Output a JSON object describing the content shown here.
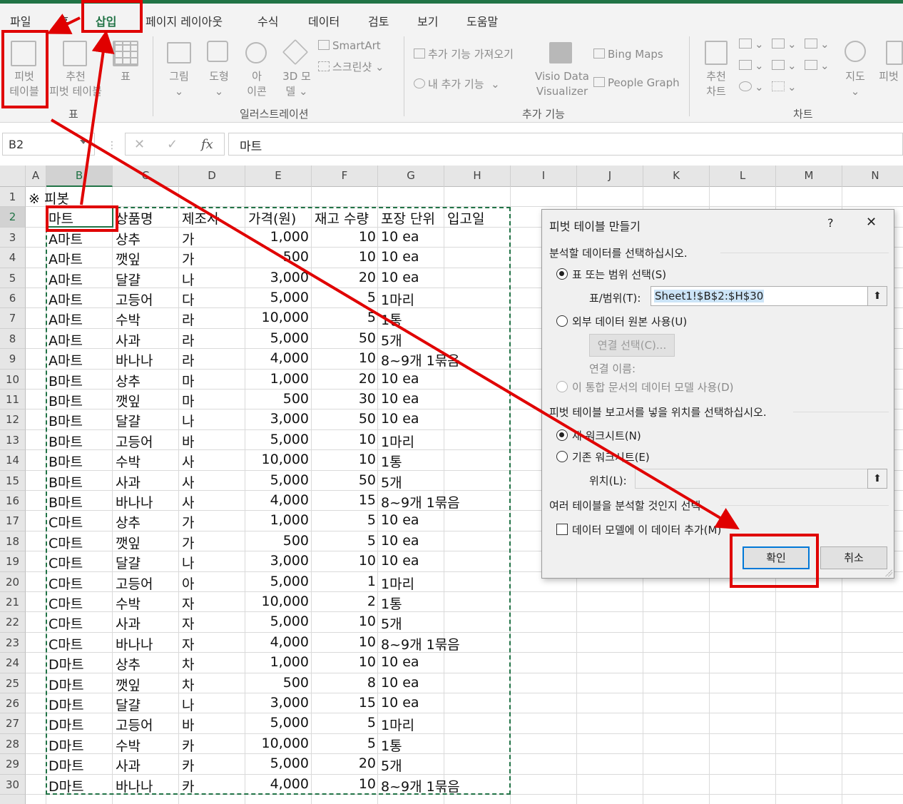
{
  "ribbon_tabs": [
    "파일",
    "홈",
    "삽입",
    "페이지 레이아웃",
    "수식",
    "데이터",
    "검토",
    "보기",
    "도움말"
  ],
  "ribbon": {
    "pivot_table": [
      "피벗",
      "테이블"
    ],
    "recommended_pivot": [
      "추천",
      "피벗 테이블"
    ],
    "table": "표",
    "group_table": "표",
    "picture": "그림",
    "shapes": "도형",
    "icons": [
      "아",
      "이콘"
    ],
    "models_3d": [
      "3D 모",
      "델"
    ],
    "smartart": "SmartArt",
    "screenshot": "스크린샷",
    "group_illustrations": "일러스트레이션",
    "get_addins": "추가 기능 가져오기",
    "my_addins": "내 추가 기능",
    "visio": [
      "Visio Data",
      "Visualizer"
    ],
    "bing_maps": "Bing Maps",
    "people_graph": "People Graph",
    "group_addins": "추가 기능",
    "recommended_charts": [
      "추천",
      "차트"
    ],
    "group_charts": "차트",
    "maps": "지도",
    "pivot_chart": "피벗"
  },
  "formula_bar": {
    "name_box": "B2",
    "cancel": "✕",
    "enter": "✓",
    "fx": "fx",
    "content": "마트"
  },
  "columns": [
    "A",
    "B",
    "C",
    "D",
    "E",
    "F",
    "G",
    "H",
    "I",
    "J",
    "K",
    "L",
    "M",
    "N"
  ],
  "row1_note": "※ 피봇",
  "headers": [
    "마트",
    "상품명",
    "제조사",
    "가격(원)",
    "재고 수량",
    "포장 단위",
    "입고일"
  ],
  "rows": [
    [
      "A마트",
      "상추",
      "가",
      "1,000",
      "10",
      "10 ea"
    ],
    [
      "A마트",
      "깻잎",
      "가",
      "500",
      "10",
      "10 ea"
    ],
    [
      "A마트",
      "달걀",
      "나",
      "3,000",
      "20",
      "10 ea"
    ],
    [
      "A마트",
      "고등어",
      "다",
      "5,000",
      "5",
      "1마리"
    ],
    [
      "A마트",
      "수박",
      "라",
      "10,000",
      "5",
      "1통"
    ],
    [
      "A마트",
      "사과",
      "라",
      "5,000",
      "50",
      "5개"
    ],
    [
      "A마트",
      "바나나",
      "라",
      "4,000",
      "10",
      "8~9개 1묶음"
    ],
    [
      "B마트",
      "상추",
      "마",
      "1,000",
      "20",
      "10 ea"
    ],
    [
      "B마트",
      "깻잎",
      "마",
      "500",
      "30",
      "10 ea"
    ],
    [
      "B마트",
      "달걀",
      "나",
      "3,000",
      "50",
      "10 ea"
    ],
    [
      "B마트",
      "고등어",
      "바",
      "5,000",
      "10",
      "1마리"
    ],
    [
      "B마트",
      "수박",
      "사",
      "10,000",
      "10",
      "1통"
    ],
    [
      "B마트",
      "사과",
      "사",
      "5,000",
      "50",
      "5개"
    ],
    [
      "B마트",
      "바나나",
      "사",
      "4,000",
      "15",
      "8~9개 1묶음"
    ],
    [
      "C마트",
      "상추",
      "가",
      "1,000",
      "5",
      "10 ea"
    ],
    [
      "C마트",
      "깻잎",
      "가",
      "500",
      "5",
      "10 ea"
    ],
    [
      "C마트",
      "달걀",
      "나",
      "3,000",
      "10",
      "10 ea"
    ],
    [
      "C마트",
      "고등어",
      "아",
      "5,000",
      "1",
      "1마리"
    ],
    [
      "C마트",
      "수박",
      "자",
      "10,000",
      "2",
      "1통"
    ],
    [
      "C마트",
      "사과",
      "자",
      "5,000",
      "10",
      "5개"
    ],
    [
      "C마트",
      "바나나",
      "자",
      "4,000",
      "10",
      "8~9개 1묶음"
    ],
    [
      "D마트",
      "상추",
      "차",
      "1,000",
      "10",
      "10 ea"
    ],
    [
      "D마트",
      "깻잎",
      "차",
      "500",
      "8",
      "10 ea"
    ],
    [
      "D마트",
      "달걀",
      "나",
      "3,000",
      "15",
      "10 ea"
    ],
    [
      "D마트",
      "고등어",
      "바",
      "5,000",
      "5",
      "1마리"
    ],
    [
      "D마트",
      "수박",
      "카",
      "10,000",
      "5",
      "1통"
    ],
    [
      "D마트",
      "사과",
      "카",
      "5,000",
      "20",
      "5개"
    ],
    [
      "D마트",
      "바나나",
      "카",
      "4,000",
      "10",
      "8~9개 1묶음"
    ]
  ],
  "dialog": {
    "title": "피벗 테이블 만들기",
    "help": "?",
    "close": "✕",
    "section1": "분석할 데이터를 선택하십시오.",
    "opt_table_range": "표 또는 범위 선택(S)",
    "table_range_label": "표/범위(T):",
    "table_range_value": "Sheet1!$B$2:$H$30",
    "opt_external": "외부 데이터 원본 사용(U)",
    "choose_connection": "연결 선택(C)...",
    "connection_name": "연결 이름:",
    "opt_data_model": "이 통합 문서의 데이터 모델 사용(D)",
    "section2": "피벗 테이블 보고서를 넣을 위치를 선택하십시오.",
    "opt_new_sheet": "새 워크시트(N)",
    "opt_existing_sheet": "기존 워크시트(E)",
    "location_label": "위치(L):",
    "section3": "여러 테이블을 분석할 것인지 선택",
    "add_to_model": "데이터 모델에 이 데이터 추가(M)",
    "ok": "확인",
    "cancel": "취소"
  },
  "colors": {
    "excel_green": "#217346",
    "highlight_red": "#e00000",
    "focus_blue": "#0078d7"
  }
}
